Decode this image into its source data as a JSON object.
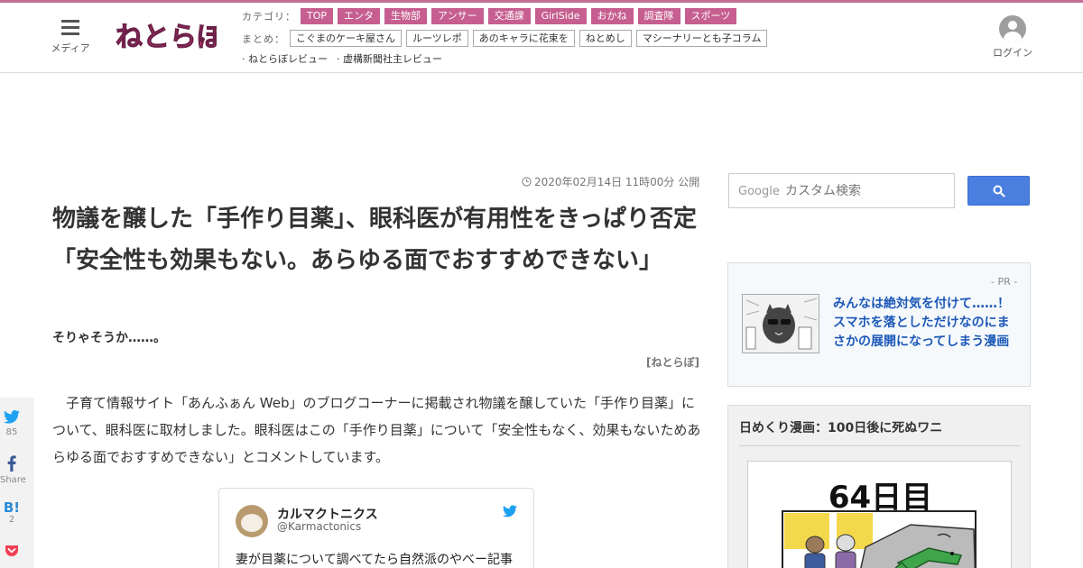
{
  "header": {
    "menu_label": "メディア",
    "logo_text": "ねとらぼ",
    "category_head": "カテゴリ：",
    "categories": [
      "TOP",
      "エンタ",
      "生物部",
      "アンサー",
      "交通課",
      "GirlSide",
      "おかね",
      "調査隊",
      "スポーツ"
    ],
    "summary_head": "まとめ：",
    "summaries": [
      "こぐまのケーキ屋さん",
      "ルーツレポ",
      "あのキャラに花束を",
      "ねとめし",
      "マシーナリーとも子コラム"
    ],
    "reviews": [
      "· ねとらぼレビュー",
      "· 虚構新聞社主レビュー"
    ],
    "login_label": "ログイン",
    "accent_color": "#c65e8f"
  },
  "article": {
    "date": "2020年02月14日 11時00分 公開",
    "title": "物議を醸した「手作り目薬」、眼科医が有用性をきっぱり否定　「安全性も効果もない。あらゆる面でおすすめできない」",
    "subtitle": "そりゃそうか……。",
    "source": "[ねとらぼ]",
    "body": "　子育て情報サイト「あんふぁん Web」のブログコーナーに掲載され物議を醸していた「手作り目薬」について、眼科医に取材しました。眼科医はこの「手作り目薬」について「安全性もなく、効果もないためあらゆる面でおすすめできない」とコメントしています。"
  },
  "tweet": {
    "name": "カルマクトニクス",
    "handle": "@Karmactonics",
    "text": "妻が目薬について調べてたら自然派のやべー記事"
  },
  "share": {
    "twitter_count": "85",
    "facebook_label": "Share",
    "hatena_label": "B!",
    "hatena_count": "2"
  },
  "sidebar": {
    "search_brand": "Google",
    "search_placeholder": "カスタム検索",
    "pr_label": "- PR -",
    "pr_text": "みんなは絶対気を付けて……！　スマホを落としただけなのにまさかの展開になってしまう漫画",
    "manga_title": "日めくり漫画：100日後に死ぬワニ",
    "manga_day": "64日目"
  },
  "icons": [
    "menu-icon",
    "avatar-icon",
    "clock-icon",
    "twitter-icon",
    "facebook-icon",
    "hatena-icon",
    "pocket-icon",
    "search-icon"
  ]
}
